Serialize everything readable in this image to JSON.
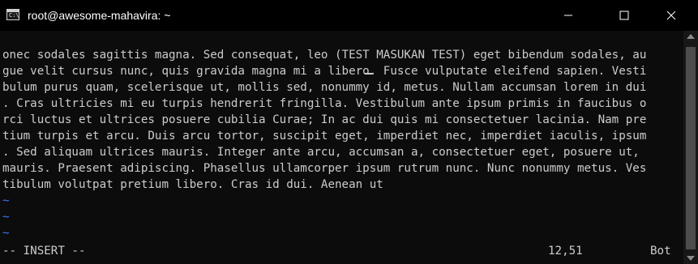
{
  "window": {
    "title": "root@awesome-mahavira: ~",
    "icon": "terminal-icon",
    "icon_prompt": "C:\\",
    "controls": [
      "minimize-icon",
      "maximize-icon",
      "close-icon"
    ]
  },
  "terminal": {
    "lines": [
      "onec sodales sagittis magna. Sed consequat, leo (TEST MASUKAN TEST) eget bibendum sodales, au",
      "gue velit cursus nunc, quis gravida magna mi a libero. Fusce vulputate eleifend sapien. Vesti",
      "bulum purus quam, scelerisque ut, mollis sed, nonummy id, metus. Nullam accumsan lorem in dui",
      ". Cras ultricies mi eu turpis hendrerit fringilla. Vestibulum ante ipsum primis in faucibus o",
      "rci luctus et ultrices posuere cubilia Curae; In ac dui quis mi consectetuer lacinia. Nam pre",
      "tium turpis et arcu. Duis arcu tortor, suscipit eget, imperdiet nec, imperdiet iaculis, ipsum",
      ". Sed aliquam ultrices mauris. Integer ante arcu, accumsan a, consectetuer eget, posuere ut,",
      "mauris. Praesent adipiscing. Phasellus ullamcorper ipsum rutrum nunc. Nunc nonummy metus. Ves",
      "tibulum volutpat pretium libero. Cras id dui. Aenean ut"
    ],
    "tildes": [
      "~",
      "~",
      "~"
    ],
    "status": {
      "mode": "-- INSERT --",
      "position": "12,51",
      "scroll": "Bot"
    }
  },
  "colors": {
    "background": "#0c0c0c",
    "titlebar": "#000000",
    "text": "#cccccc",
    "tilde": "#3b78ff",
    "scrollbar": "#171717",
    "scroll_thumb": "#4d4d4d"
  }
}
